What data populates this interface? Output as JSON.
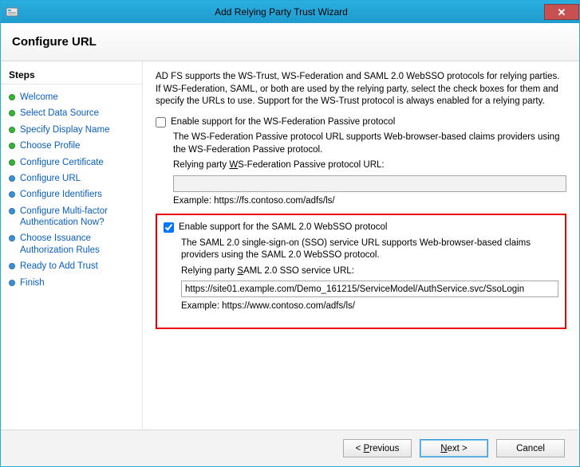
{
  "window": {
    "title": "Add Relying Party Trust Wizard"
  },
  "header": {
    "heading": "Configure URL"
  },
  "sidebar": {
    "title": "Steps",
    "items": [
      {
        "label": "Welcome",
        "state": "done"
      },
      {
        "label": "Select Data Source",
        "state": "done"
      },
      {
        "label": "Specify Display Name",
        "state": "done"
      },
      {
        "label": "Choose Profile",
        "state": "done"
      },
      {
        "label": "Configure Certificate",
        "state": "done"
      },
      {
        "label": "Configure URL",
        "state": "pending"
      },
      {
        "label": "Configure Identifiers",
        "state": "pending"
      },
      {
        "label": "Configure Multi-factor Authentication Now?",
        "state": "pending"
      },
      {
        "label": "Choose Issuance Authorization Rules",
        "state": "pending"
      },
      {
        "label": "Ready to Add Trust",
        "state": "pending"
      },
      {
        "label": "Finish",
        "state": "pending"
      }
    ]
  },
  "content": {
    "intro": "AD FS supports the WS-Trust, WS-Federation and SAML 2.0 WebSSO protocols for relying parties.  If WS-Federation, SAML, or both are used by the relying party, select the check boxes for them and specify the URLs to use.  Support for the WS-Trust protocol is always enabled for a relying party.",
    "wsfed": {
      "checkbox_label_pre": "Enable support for the WS-Federation Passive protocol",
      "desc": "The WS-Federation Passive protocol URL supports Web-browser-based claims providers using the WS-Federation Passive protocol.",
      "field_label_pre": "Relying party ",
      "field_label_u": "W",
      "field_label_post": "S-Federation Passive protocol URL:",
      "value": "",
      "example": "Example: https://fs.contoso.com/adfs/ls/",
      "checked": false,
      "enabled": false
    },
    "saml": {
      "checkbox_label_pre": "Enable support for the SAML 2.0 WebSSO protocol",
      "desc": "The SAML 2.0 single-sign-on (SSO) service URL supports Web-browser-based claims providers using the SAML 2.0 WebSSO protocol.",
      "field_label_pre": "Relying party ",
      "field_label_u": "S",
      "field_label_post": "AML 2.0 SSO service URL:",
      "value": "https://site01.example.com/Demo_161215/ServiceModel/AuthService.svc/SsoLogin",
      "example": "Example: https://www.contoso.com/adfs/ls/",
      "checked": true,
      "enabled": true
    }
  },
  "footer": {
    "previous_pre": "< ",
    "previous_u": "P",
    "previous_post": "revious",
    "next_u": "N",
    "next_post": "ext >",
    "cancel": "Cancel"
  }
}
